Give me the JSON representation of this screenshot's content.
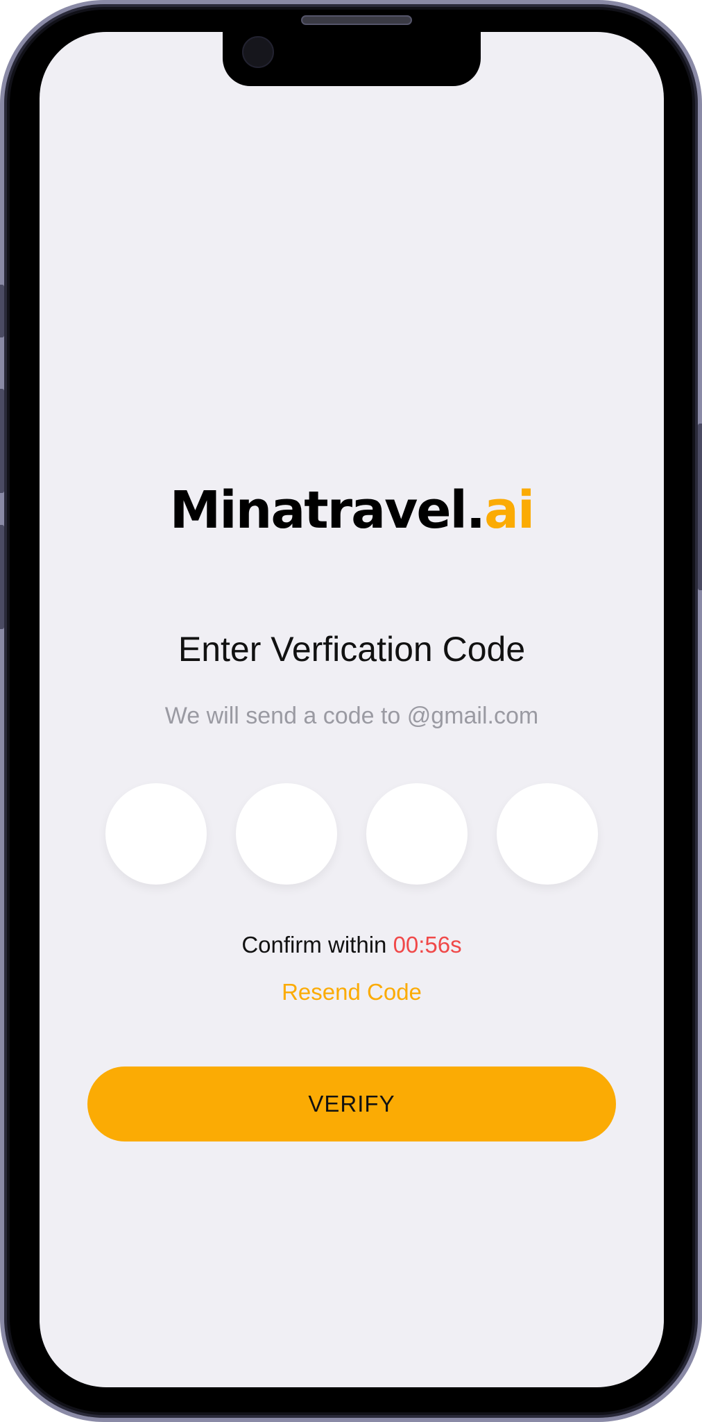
{
  "brand": {
    "logo_main": "Minatravel.",
    "logo_accent": "ai",
    "accent_color": "#fbab04"
  },
  "verification": {
    "title": "Enter Verfication Code",
    "subtitle": "We will send a code to @gmail.com",
    "code_digits": [
      "",
      "",
      "",
      ""
    ],
    "confirm_prefix": "Confirm within ",
    "timer": "00:56s",
    "timer_color": "#f04848",
    "resend_label": "Resend Code",
    "verify_label": "VERIFY"
  },
  "colors": {
    "screen_background": "#f0eff4",
    "button_background": "#fbab04"
  }
}
